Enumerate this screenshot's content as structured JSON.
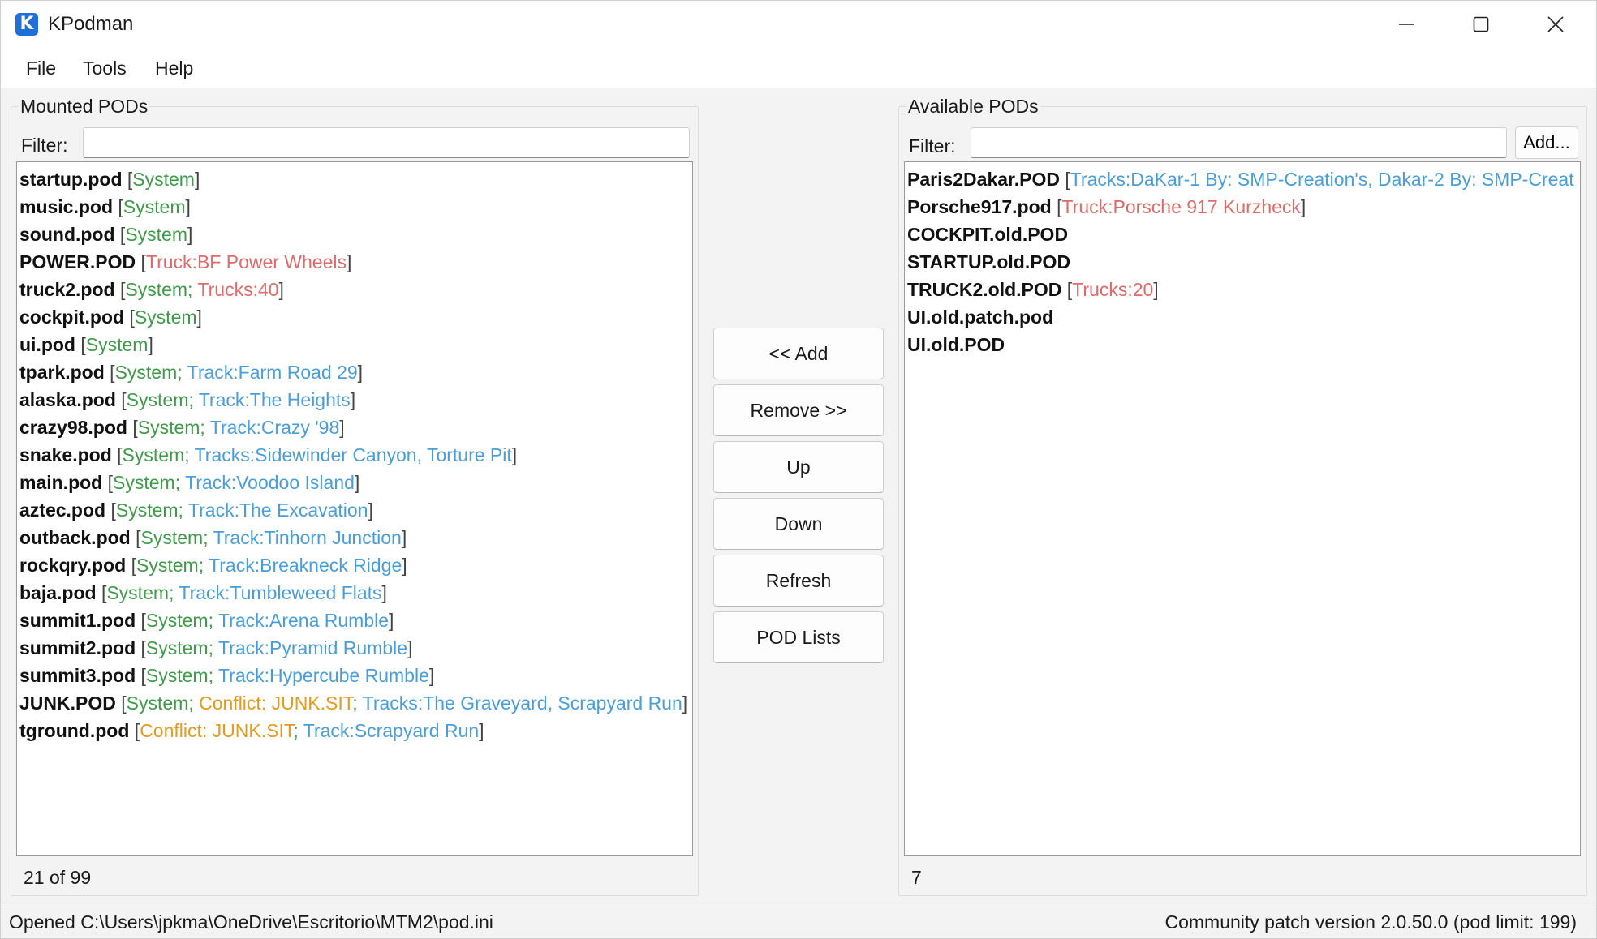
{
  "window": {
    "title": "KPodman",
    "icon_letter": "K",
    "icon_color": "#1f6fd6"
  },
  "menu": [
    "File",
    "Tools",
    "Help"
  ],
  "mounted": {
    "title": "Mounted PODs",
    "filter_label": "Filter:",
    "filter_value": "",
    "items": [
      {
        "name": "startup.pod",
        "tags": [
          {
            "text": "System",
            "kind": "system"
          }
        ]
      },
      {
        "name": "music.pod",
        "tags": [
          {
            "text": "System",
            "kind": "system"
          }
        ]
      },
      {
        "name": "sound.pod",
        "tags": [
          {
            "text": "System",
            "kind": "system"
          }
        ]
      },
      {
        "name": "POWER.POD",
        "tags": [
          {
            "text": "Truck:BF Power Wheels",
            "kind": "truck"
          }
        ]
      },
      {
        "name": "truck2.pod",
        "tags": [
          {
            "text": "System",
            "kind": "system"
          },
          {
            "text": "Trucks:40",
            "kind": "truck"
          }
        ]
      },
      {
        "name": "cockpit.pod",
        "tags": [
          {
            "text": "System",
            "kind": "system"
          }
        ]
      },
      {
        "name": "ui.pod",
        "tags": [
          {
            "text": "System",
            "kind": "system"
          }
        ]
      },
      {
        "name": "tpark.pod",
        "tags": [
          {
            "text": "System",
            "kind": "system"
          },
          {
            "text": "Track:Farm Road 29",
            "kind": "track"
          }
        ]
      },
      {
        "name": "alaska.pod",
        "tags": [
          {
            "text": "System",
            "kind": "system"
          },
          {
            "text": "Track:The Heights",
            "kind": "track"
          }
        ]
      },
      {
        "name": "crazy98.pod",
        "tags": [
          {
            "text": "System",
            "kind": "system"
          },
          {
            "text": "Track:Crazy '98",
            "kind": "track"
          }
        ]
      },
      {
        "name": "snake.pod",
        "tags": [
          {
            "text": "System",
            "kind": "system"
          },
          {
            "text": "Tracks:Sidewinder Canyon, Torture Pit",
            "kind": "track"
          }
        ]
      },
      {
        "name": "main.pod",
        "tags": [
          {
            "text": "System",
            "kind": "system"
          },
          {
            "text": "Track:Voodoo Island",
            "kind": "track"
          }
        ]
      },
      {
        "name": "aztec.pod",
        "tags": [
          {
            "text": "System",
            "kind": "system"
          },
          {
            "text": "Track:The Excavation",
            "kind": "track"
          }
        ]
      },
      {
        "name": "outback.pod",
        "tags": [
          {
            "text": "System",
            "kind": "system"
          },
          {
            "text": "Track:Tinhorn Junction",
            "kind": "track"
          }
        ]
      },
      {
        "name": "rockqry.pod",
        "tags": [
          {
            "text": "System",
            "kind": "system"
          },
          {
            "text": "Track:Breakneck Ridge",
            "kind": "track"
          }
        ]
      },
      {
        "name": "baja.pod",
        "tags": [
          {
            "text": "System",
            "kind": "system"
          },
          {
            "text": "Track:Tumbleweed Flats",
            "kind": "track"
          }
        ]
      },
      {
        "name": "summit1.pod",
        "tags": [
          {
            "text": "System",
            "kind": "system"
          },
          {
            "text": "Track:Arena Rumble",
            "kind": "track"
          }
        ]
      },
      {
        "name": "summit2.pod",
        "tags": [
          {
            "text": "System",
            "kind": "system"
          },
          {
            "text": "Track:Pyramid Rumble",
            "kind": "track"
          }
        ]
      },
      {
        "name": "summit3.pod",
        "tags": [
          {
            "text": "System",
            "kind": "system"
          },
          {
            "text": "Track:Hypercube Rumble",
            "kind": "track"
          }
        ]
      },
      {
        "name": "JUNK.POD",
        "tags": [
          {
            "text": "System",
            "kind": "system"
          },
          {
            "text": "Conflict: JUNK.SIT",
            "kind": "conflict"
          },
          {
            "text": "Tracks:The Graveyard, Scrapyard Run",
            "kind": "track"
          }
        ]
      },
      {
        "name": "tground.pod",
        "tags": [
          {
            "text": "Conflict: JUNK.SIT",
            "kind": "conflict"
          },
          {
            "text": "Track:Scrapyard Run",
            "kind": "track"
          }
        ]
      }
    ],
    "count_label": "21 of 99"
  },
  "available": {
    "title": "Available PODs",
    "filter_label": "Filter:",
    "filter_value": "",
    "add_button": "Add...",
    "items": [
      {
        "name": "Paris2Dakar.POD",
        "tags": [
          {
            "text": "Tracks:DaKar-1 By: SMP-Creation's, Dakar-2 By: SMP-Creat",
            "kind": "track"
          }
        ],
        "truncated": true
      },
      {
        "name": "Porsche917.pod",
        "tags": [
          {
            "text": "Truck:Porsche 917 Kurzheck",
            "kind": "truck"
          }
        ]
      },
      {
        "name": "COCKPIT.old.POD",
        "tags": []
      },
      {
        "name": "STARTUP.old.POD",
        "tags": []
      },
      {
        "name": "TRUCK2.old.POD",
        "tags": [
          {
            "text": "Trucks:20",
            "kind": "truck"
          }
        ]
      },
      {
        "name": "UI.old.patch.pod",
        "tags": []
      },
      {
        "name": "UI.old.POD",
        "tags": []
      }
    ],
    "count_label": "7"
  },
  "actions": {
    "add": "<< Add",
    "remove": "Remove >>",
    "up": "Up",
    "down": "Down",
    "refresh": "Refresh",
    "pod_lists": "POD Lists"
  },
  "status": {
    "left": "Opened C:\\Users\\jpkma\\OneDrive\\Escritorio\\MTM2\\pod.ini",
    "right": "Community patch version 2.0.50.0 (pod limit: 199)"
  },
  "colors": {
    "system": "#3f9a4a",
    "track": "#4a9ed8",
    "truck": "#e06a6a",
    "conflict": "#e49a1e"
  },
  "icons": {
    "minimize": "minimize-icon",
    "maximize": "maximize-icon",
    "close": "close-icon"
  }
}
